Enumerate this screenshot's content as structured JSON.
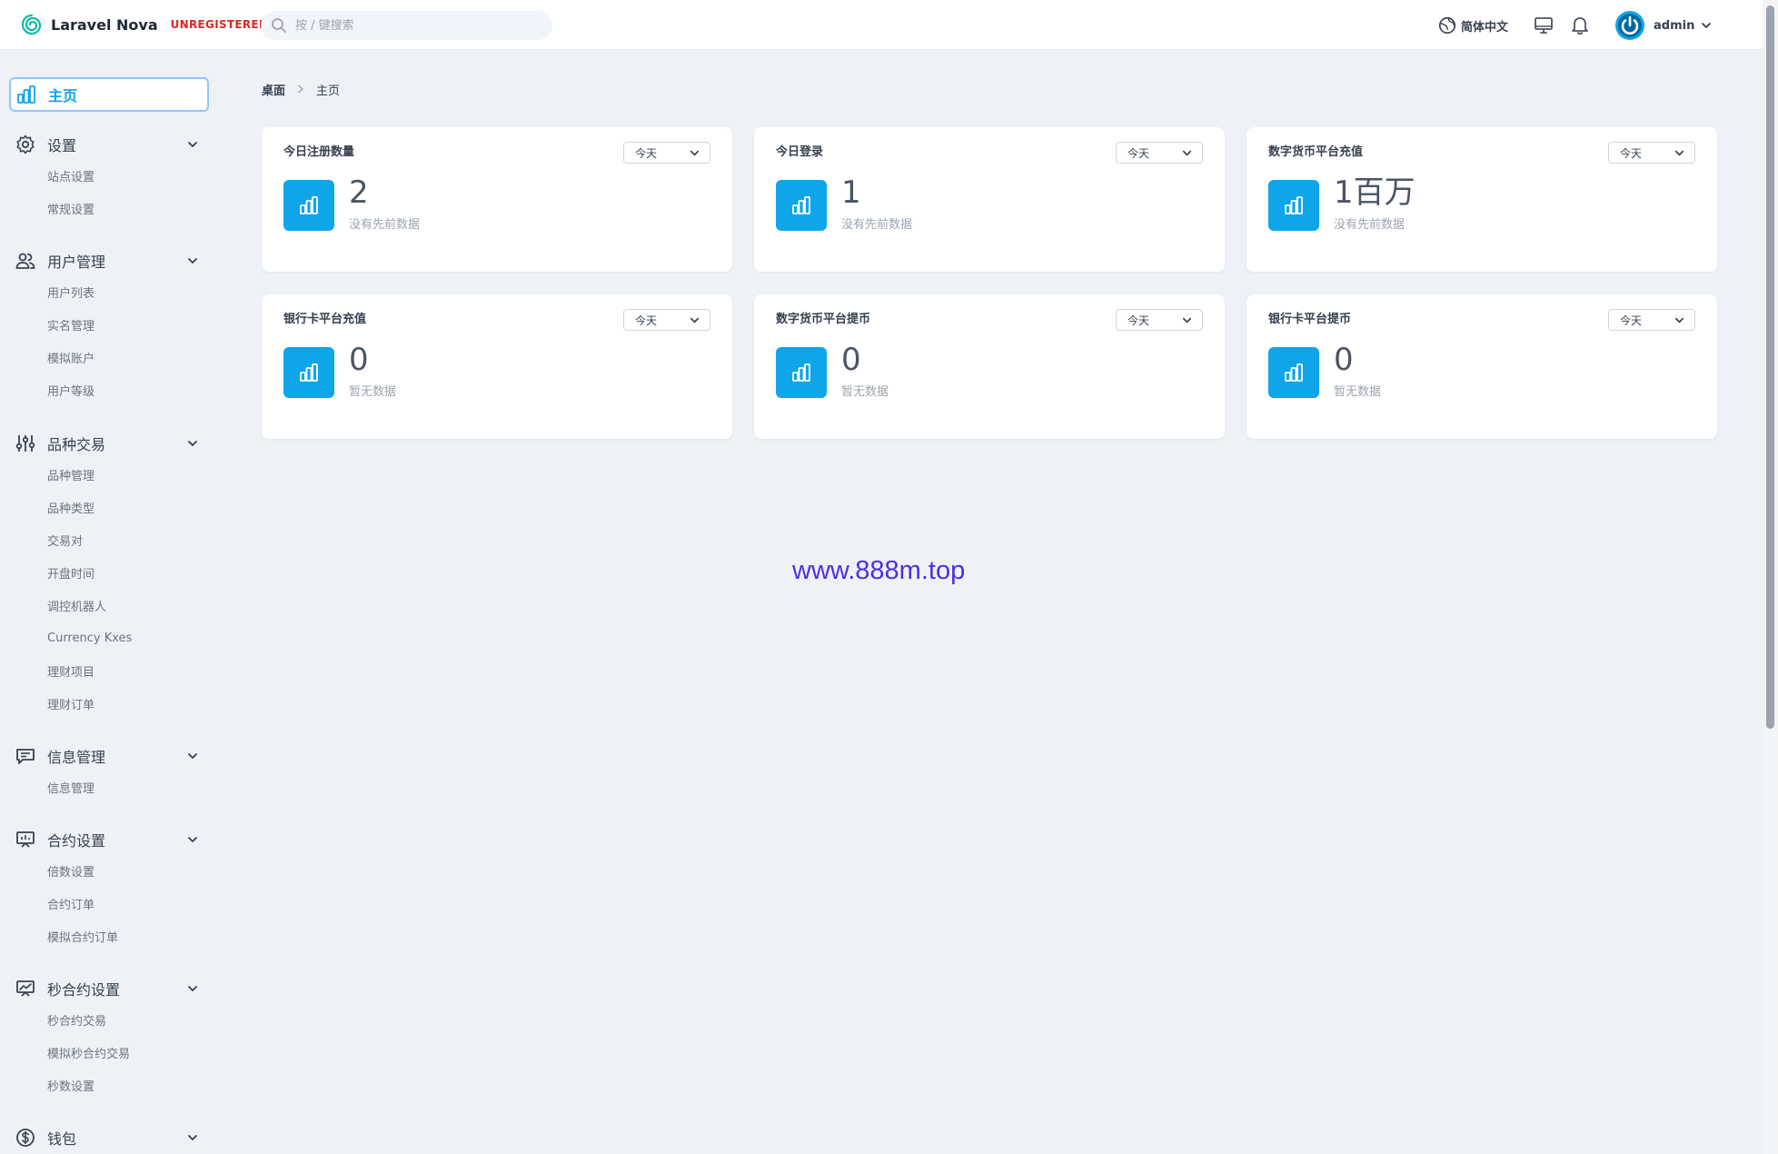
{
  "app": {
    "brand": "Laravel Nova",
    "badge": "UNREGISTERED"
  },
  "search": {
    "placeholder": "按 / 键搜索"
  },
  "topbar": {
    "language": "简体中文",
    "user": "admin"
  },
  "sidebar": {
    "home": "主页",
    "sections": [
      {
        "label": "设置",
        "icon": "gear-icon",
        "items": [
          "站点设置",
          "常规设置"
        ]
      },
      {
        "label": "用户管理",
        "icon": "users-icon",
        "items": [
          "用户列表",
          "实名管理",
          "模拟账户",
          "用户等级"
        ]
      },
      {
        "label": "品种交易",
        "icon": "sliders-icon",
        "items": [
          "品种管理",
          "品种类型",
          "交易对",
          "开盘时间",
          "调控机器人",
          "Currency Kxes",
          "理财项目",
          "理财订单"
        ]
      },
      {
        "label": "信息管理",
        "icon": "message-icon",
        "items": [
          "信息管理"
        ]
      },
      {
        "label": "合约设置",
        "icon": "presentation-icon",
        "items": [
          "倍数设置",
          "合约订单",
          "模拟合约订单"
        ]
      },
      {
        "label": "秒合约设置",
        "icon": "chart-board-icon",
        "items": [
          "秒合约交易",
          "模拟秒合约交易",
          "秒数设置"
        ]
      },
      {
        "label": "钱包",
        "icon": "dollar-icon",
        "items": []
      }
    ]
  },
  "breadcrumb": {
    "root": "桌面",
    "current": "主页"
  },
  "cards": [
    {
      "title": "今日注册数量",
      "range": "今天",
      "value": "2",
      "note": "没有先前数据"
    },
    {
      "title": "今日登录",
      "range": "今天",
      "value": "1",
      "note": "没有先前数据"
    },
    {
      "title": "数字货币平台充值",
      "range": "今天",
      "value": "1百万",
      "note": "没有先前数据"
    },
    {
      "title": "银行卡平台充值",
      "range": "今天",
      "value": "0",
      "note": "暂无数据"
    },
    {
      "title": "数字货币平台提币",
      "range": "今天",
      "value": "0",
      "note": "暂无数据"
    },
    {
      "title": "银行卡平台提币",
      "range": "今天",
      "value": "0",
      "note": "暂无数据"
    }
  ],
  "watermark": "www.888m.top",
  "colors": {
    "accent": "#0ea5e9",
    "badge": "#dc2626",
    "background": "#eef2f6"
  }
}
